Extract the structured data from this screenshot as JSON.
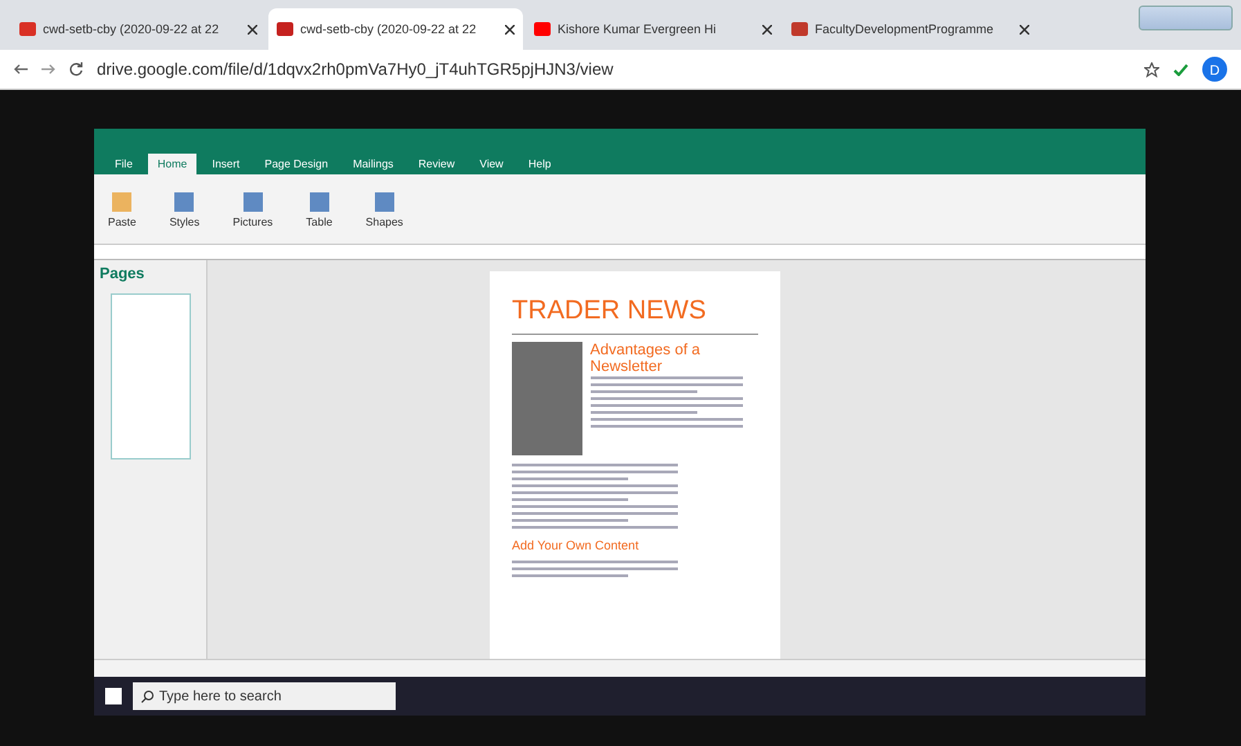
{
  "browser_tabs": [
    {
      "title": "cwd-setb-cby (2020-09-22 at 22",
      "kind": "gmail",
      "selected": false
    },
    {
      "title": "cwd-setb-cby (2020-09-22 at 22",
      "kind": "clapper",
      "selected": true
    },
    {
      "title": "Kishore Kumar Evergreen Hi",
      "kind": "youtube",
      "selected": false
    },
    {
      "title": "FacultyDevelopmentProgramme",
      "kind": "pdf",
      "selected": false
    }
  ],
  "address_bar": {
    "url": "drive.google.com/file/d/1dqvx2rh0pmVa7Hy0_jT4uhTGR5pjHJN3/view"
  },
  "profile": {
    "initial": "D"
  },
  "publisher": {
    "ribbon_tabs": [
      {
        "label": "File",
        "selected": false
      },
      {
        "label": "Home",
        "selected": true
      },
      {
        "label": "Insert",
        "selected": false
      },
      {
        "label": "Page Design",
        "selected": false
      },
      {
        "label": "Mailings",
        "selected": false
      },
      {
        "label": "Review",
        "selected": false
      },
      {
        "label": "View",
        "selected": false
      },
      {
        "label": "Help",
        "selected": false
      }
    ],
    "ribbon_buttons": [
      "Paste",
      "Styles",
      "Pictures",
      "Table",
      "Shapes"
    ],
    "pages_label": "Pages",
    "newsletter": {
      "headline": "TRADER NEWS",
      "article_title": "Advantages of a Newsletter",
      "section_title": "Add Your Own Content"
    }
  },
  "taskbar": {
    "search_placeholder": "Type here to search"
  }
}
